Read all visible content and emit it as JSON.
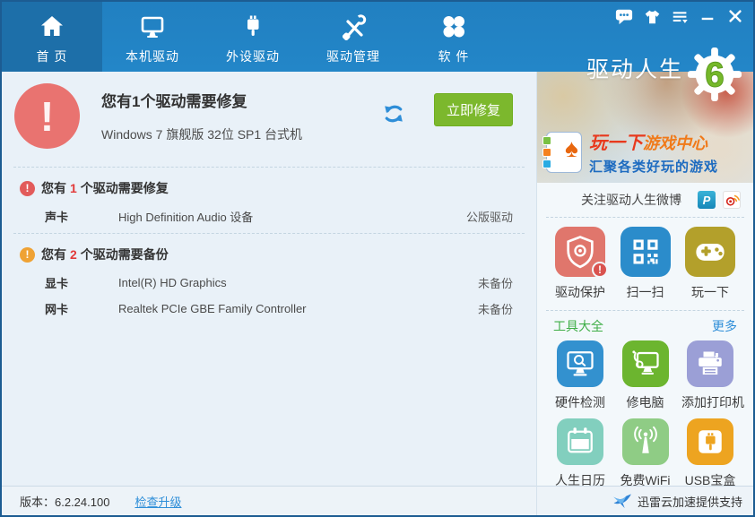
{
  "nav": {
    "tabs": [
      {
        "label": "首 页",
        "active": true,
        "icon": "home-icon"
      },
      {
        "label": "本机驱动",
        "active": false,
        "icon": "monitor-icon"
      },
      {
        "label": "外设驱动",
        "active": false,
        "icon": "usb-plug-icon"
      },
      {
        "label": "驱动管理",
        "active": false,
        "icon": "tools-icon"
      },
      {
        "label": "软 件",
        "active": false,
        "icon": "clover-icon"
      }
    ]
  },
  "titlebar": {
    "logo_text": "驱动人生",
    "logo_badge": "6",
    "icons": [
      "feedback-icon",
      "skin-icon",
      "menu-icon",
      "minimize-icon",
      "close-icon"
    ]
  },
  "main": {
    "alert": {
      "title": "您有1个驱动需要修复",
      "subtitle": "Windows 7 旗舰版  32位 SP1 台式机",
      "fix_button": "立即修复"
    },
    "repair_section": {
      "prefix": "您有",
      "count": "1",
      "suffix": "个驱动需要修复",
      "rows": [
        {
          "type": "声卡",
          "name": "High Definition Audio 设备",
          "status": "公版驱动"
        }
      ]
    },
    "backup_section": {
      "prefix": "您有",
      "count": "2",
      "suffix": "个驱动需要备份",
      "rows": [
        {
          "type": "显卡",
          "name": "Intel(R) HD Graphics",
          "status": "未备份"
        },
        {
          "type": "网卡",
          "name": "Realtek PCIe GBE Family Controller",
          "status": "未备份"
        }
      ]
    },
    "footer": {
      "version": "版本：6.2.24.100",
      "upgrade_link": "检查升级"
    }
  },
  "sidebar": {
    "banner": {
      "line1_part1": "玩一下",
      "line1_part2": "游戏中心",
      "line2": "汇聚各类好玩的游戏",
      "card_icon": "spade-card-icon",
      "spade": "♠"
    },
    "weibo": {
      "label": "关注驱动人生微博",
      "tencent_glyph": "P",
      "icons": [
        "tencent-weibo-icon",
        "sina-weibo-icon"
      ]
    },
    "shortcuts": [
      {
        "label": "驱动保护",
        "icon": "shield-gear-icon",
        "badge": "!",
        "color": "#e0766c"
      },
      {
        "label": "扫一扫",
        "icon": "qr-code-icon",
        "color": "#2b8ccb"
      },
      {
        "label": "玩一下",
        "icon": "gamepad-icon",
        "color": "#b3a02b"
      }
    ],
    "tools_header": {
      "title": "工具大全",
      "more": "更多"
    },
    "tools": [
      {
        "label": "硬件检测",
        "icon": "monitor-magnifier-icon",
        "color": "#3391cf"
      },
      {
        "label": "修电脑",
        "icon": "monitor-stethoscope-icon",
        "color": "#6cb52f"
      },
      {
        "label": "添加打印机",
        "icon": "printer-icon",
        "color": "#9b9fd6"
      },
      {
        "label": "人生日历",
        "icon": "calendar-icon",
        "color": "#82cfbe"
      },
      {
        "label": "免费WiFi",
        "icon": "wifi-antenna-icon",
        "color": "#8fcc85"
      },
      {
        "label": "USB宝盒",
        "icon": "usb-box-icon",
        "color": "#eda420"
      }
    ],
    "footer": {
      "label": "迅雷云加速提供支持",
      "icon": "xunlei-bird-icon"
    }
  },
  "colors": {
    "navbar": "#2386c8",
    "navbar_active_tab": "#1d6fa9",
    "window_border": "#1c5c92",
    "panel_bg": "#e9f1f8",
    "sidebar_bg": "#f3f8fb",
    "alert_red": "#e97370",
    "warn_orange": "#efa234",
    "count_red": "#e23a3a",
    "button_green": "#7cb82d",
    "link_blue": "#2e8ed8",
    "tools_green": "#3fae47",
    "logo_badge_green": "#76b82a"
  }
}
